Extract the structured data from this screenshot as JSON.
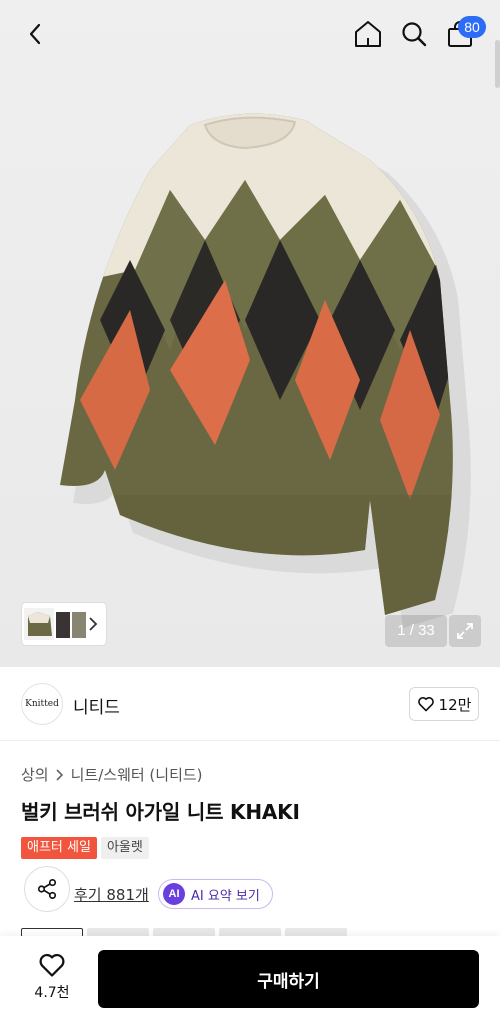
{
  "header": {
    "cart_count": "80"
  },
  "gallery": {
    "pager": "1 / 33"
  },
  "brand": {
    "logo_text": "Knitted",
    "name": "니티드",
    "like_count": "12만"
  },
  "product": {
    "breadcrumb": [
      "상의",
      "니트/스웨터 (니티드)"
    ],
    "title": "벌키 브러쉬 아가일 니트 KHAKI",
    "tags": [
      "애프터 세일",
      "아울렛"
    ],
    "reviews": "후기 881개",
    "ai_badge": "AI",
    "ai_label": "AI 요약 보기"
  },
  "bottom": {
    "fav_count": "4.7천",
    "buy_label": "구매하기"
  },
  "colors": {
    "accent_blue": "#2d6cf6",
    "sale_red": "#f1553d",
    "ai_purple": "#6a3fe0"
  },
  "icons": [
    "back-icon",
    "home-icon",
    "search-icon",
    "shopping-bag-icon",
    "chevron-right-icon",
    "expand-icon",
    "heart-icon",
    "share-icon"
  ]
}
